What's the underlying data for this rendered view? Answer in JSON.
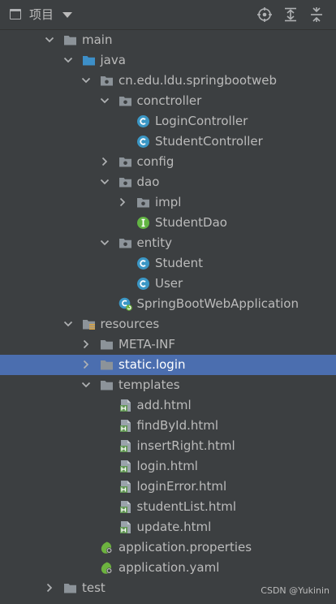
{
  "header": {
    "title": "项目"
  },
  "tree": [
    {
      "label": "main",
      "icon": "folder-icon",
      "arrow": "expanded",
      "indent": 0
    },
    {
      "label": "java",
      "icon": "source-folder-icon",
      "arrow": "expanded",
      "indent": 1
    },
    {
      "label": "cn.edu.ldu.springbootweb",
      "icon": "package-icon",
      "arrow": "expanded",
      "indent": 2
    },
    {
      "label": "conctroller",
      "icon": "package-icon",
      "arrow": "expanded",
      "indent": 3
    },
    {
      "label": "LoginController",
      "icon": "class-icon",
      "arrow": "none",
      "indent": 4
    },
    {
      "label": "StudentController",
      "icon": "class-icon",
      "arrow": "none",
      "indent": 4
    },
    {
      "label": "config",
      "icon": "package-icon",
      "arrow": "collapsed",
      "indent": 3
    },
    {
      "label": "dao",
      "icon": "package-icon",
      "arrow": "expanded",
      "indent": 3
    },
    {
      "label": "impl",
      "icon": "package-icon",
      "arrow": "collapsed",
      "indent": 4
    },
    {
      "label": "StudentDao",
      "icon": "interface-icon",
      "arrow": "none",
      "indent": 4
    },
    {
      "label": "entity",
      "icon": "package-icon",
      "arrow": "expanded",
      "indent": 3
    },
    {
      "label": "Student",
      "icon": "class-icon",
      "arrow": "none",
      "indent": 4
    },
    {
      "label": "User",
      "icon": "class-icon",
      "arrow": "none",
      "indent": 4
    },
    {
      "label": "SpringBootWebApplication",
      "icon": "spring-boot-class-icon",
      "arrow": "none",
      "indent": 3
    },
    {
      "label": "resources",
      "icon": "resources-folder-icon",
      "arrow": "expanded",
      "indent": 1
    },
    {
      "label": "META-INF",
      "icon": "folder-icon",
      "arrow": "collapsed",
      "indent": 2
    },
    {
      "label": "static.login",
      "icon": "folder-icon",
      "arrow": "collapsed",
      "indent": 2,
      "selected": true
    },
    {
      "label": "templates",
      "icon": "folder-icon",
      "arrow": "expanded",
      "indent": 2
    },
    {
      "label": "add.html",
      "icon": "html-file-icon",
      "arrow": "none",
      "indent": 3
    },
    {
      "label": "findById.html",
      "icon": "html-file-icon",
      "arrow": "none",
      "indent": 3
    },
    {
      "label": "insertRight.html",
      "icon": "html-file-icon",
      "arrow": "none",
      "indent": 3
    },
    {
      "label": "login.html",
      "icon": "html-file-icon",
      "arrow": "none",
      "indent": 3
    },
    {
      "label": "loginError.html",
      "icon": "html-file-icon",
      "arrow": "none",
      "indent": 3
    },
    {
      "label": "studentList.html",
      "icon": "html-file-icon",
      "arrow": "none",
      "indent": 3
    },
    {
      "label": "update.html",
      "icon": "html-file-icon",
      "arrow": "none",
      "indent": 3
    },
    {
      "label": "application.properties",
      "icon": "spring-config-icon",
      "arrow": "none",
      "indent": 2
    },
    {
      "label": "application.yaml",
      "icon": "spring-config-icon",
      "arrow": "none",
      "indent": 2
    },
    {
      "label": "test",
      "icon": "folder-icon",
      "arrow": "collapsed",
      "indent": 0
    }
  ],
  "colors": {
    "background": "#3c3f41",
    "selection": "#4b6eaf",
    "text": "#bbbbbb",
    "folder": "#8c9399",
    "source_folder": "#3d8fc8",
    "class": "#3b97c5",
    "interface": "#62b543",
    "html_green": "#629755"
  },
  "watermark": "CSDN @Yukinin"
}
